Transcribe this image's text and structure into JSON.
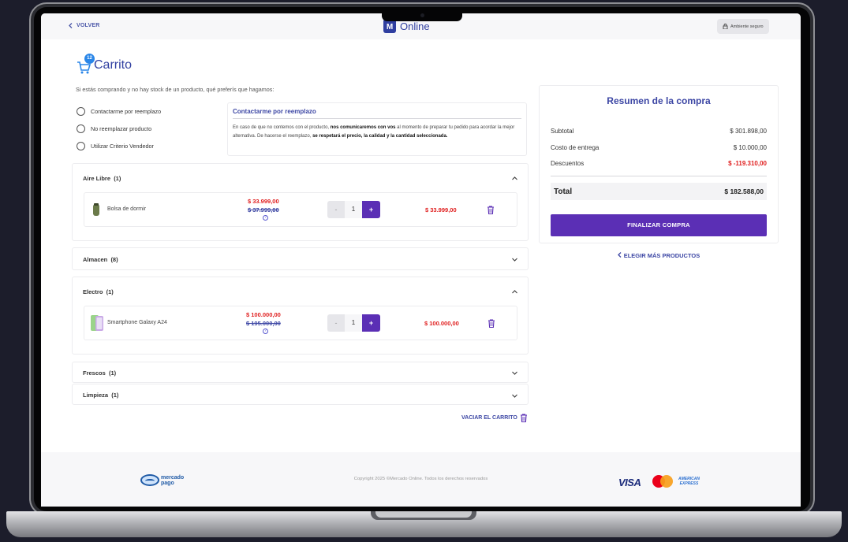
{
  "header": {
    "back_label": "VOLVER",
    "logo_text": "Online",
    "secure_label": "Ambiente seguro"
  },
  "cart": {
    "title": "Carrito",
    "badge_count": "12",
    "question": "Si estás comprando y no hay stock de un producto, qué preferís que hagamos:"
  },
  "options": [
    {
      "label": "Contactarme por reemplazo"
    },
    {
      "label": "No reemplazar producto"
    },
    {
      "label": "Utilizar Criterio Vendedor"
    }
  ],
  "info": {
    "title": "Contactarme por reemplazo",
    "text_1": "En caso de que no contemos con el producto, ",
    "bold_1": "nos comunicaremos con vos",
    "text_2": " al momento de preparar tu pedido para acordar la mejor alternativa. De hacerse el reemplazo, ",
    "bold_2": "se respetará el precio, la calidad y la cantidad seleccionada."
  },
  "categories": [
    {
      "name": "Aire Libre",
      "count": "(1)",
      "expanded": true,
      "items": [
        {
          "name": "Bolsa de dormir",
          "price_new": "$ 33.999,00",
          "price_old": "$ 37.999,00",
          "qty": "1",
          "total": "$ 33.999,00"
        }
      ]
    },
    {
      "name": "Almacen",
      "count": "(8)",
      "expanded": false
    },
    {
      "name": "Electro",
      "count": "(1)",
      "expanded": true,
      "items": [
        {
          "name": "Smartphone Galaxy A24",
          "price_new": "$ 100.000,00",
          "price_old": "$ 195.000,00",
          "qty": "1",
          "total": "$ 100.000,00"
        }
      ]
    },
    {
      "name": "Frescos",
      "count": "(1)",
      "expanded": false
    },
    {
      "name": "Limpieza",
      "count": "(1)",
      "expanded": false
    }
  ],
  "stepper": {
    "minus": "-",
    "plus": "+"
  },
  "empty_cart_label": "VACIAR EL CARRITO",
  "summary": {
    "title": "Resumen de la compra",
    "rows": [
      {
        "label": "Subtotal",
        "value": "$ 301.898,00"
      },
      {
        "label": "Costo de entrega",
        "value": "$ 10.000,00"
      },
      {
        "label": "Descuentos",
        "value": "$ -119.310,00"
      }
    ],
    "total_label": "Total",
    "total_value": "$ 182.588,00",
    "finalize_label": "FINALIZAR COMPRA",
    "more_label": "ELEGIR MÁS PRODUCTOS"
  },
  "footer": {
    "mp_line1": "mercado",
    "mp_line2": "pago",
    "copyright": "Copyright 2025 ©Mercado Online. Todos los derechos reservados",
    "visa": "VISA",
    "amex_line1": "AMERICAN",
    "amex_line2": "EXPRESS"
  },
  "colors": {
    "brand": "#2f3ea0",
    "accent": "#5b2fb5",
    "price_red": "#e02020"
  },
  "icons": [
    "chevron-left-icon",
    "lock-icon",
    "cart-icon",
    "chevron-up-icon",
    "chevron-down-icon",
    "trash-icon",
    "help-icon",
    "sleeping-bag-icon",
    "smartphone-icon"
  ]
}
